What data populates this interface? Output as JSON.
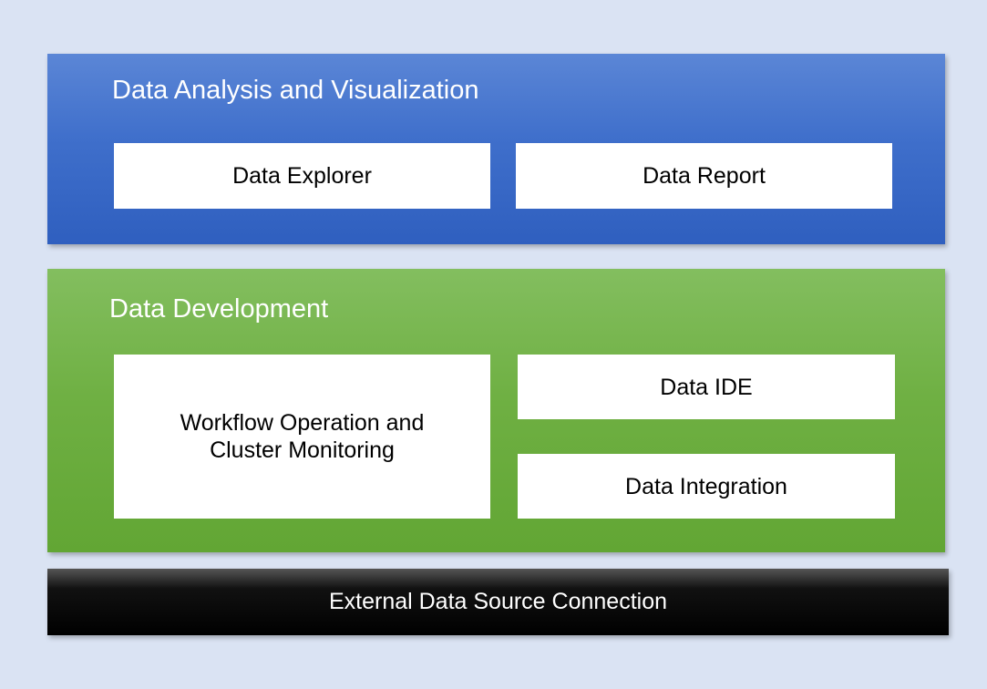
{
  "diagram": {
    "analysis_layer": {
      "title": "Data Analysis and Visualization",
      "boxes": [
        "Data Explorer",
        "Data Report"
      ]
    },
    "development_layer": {
      "title": "Data Development",
      "boxes": [
        "Workflow Operation and Cluster Monitoring",
        "Data IDE",
        "Data Integration"
      ]
    },
    "external_layer": {
      "title": "External Data Source Connection"
    }
  },
  "colors": {
    "background": "#dae3f3",
    "analysis_blue": "#4472c4",
    "development_green": "#70ad47",
    "external_black": "#000000",
    "box_white": "#ffffff"
  }
}
